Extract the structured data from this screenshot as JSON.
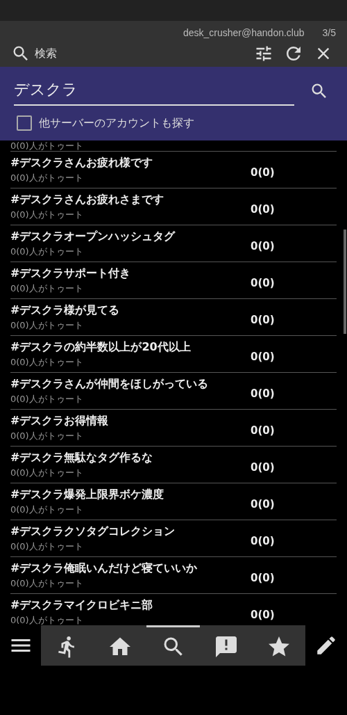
{
  "header": {
    "account": "desk_crusher@handon.club",
    "page": "3/5",
    "title": "検索"
  },
  "search_panel": {
    "query": "デスクラ",
    "other_servers": {
      "label": "他サーバーのアカウントも探す",
      "checked": false
    }
  },
  "partial_row": {
    "subtitle": "0(0)人がトゥート"
  },
  "results": [
    {
      "tag": "#デスクラさんお疲れ様です",
      "subtitle": "0(0)人がトゥート",
      "count": "0(0)"
    },
    {
      "tag": "#デスクラさんお疲れさまです",
      "subtitle": "0(0)人がトゥート",
      "count": "0(0)"
    },
    {
      "tag": "#デスクラオープンハッシュタグ",
      "subtitle": "0(0)人がトゥート",
      "count": "0(0)"
    },
    {
      "tag": "#デスクラサポート付き",
      "subtitle": "0(0)人がトゥート",
      "count": "0(0)"
    },
    {
      "tag": "#デスクラ様が見てる",
      "subtitle": "0(0)人がトゥート",
      "count": "0(0)"
    },
    {
      "tag": "#デスクラの約半数以上が20代以上",
      "subtitle": "0(0)人がトゥート",
      "count": "0(0)"
    },
    {
      "tag": "#デスクラさんが仲間をほしがっている",
      "subtitle": "0(0)人がトゥート",
      "count": "0(0)"
    },
    {
      "tag": "#デスクラお得情報",
      "subtitle": "0(0)人がトゥート",
      "count": "0(0)"
    },
    {
      "tag": "#デスクラ無駄なタグ作るな",
      "subtitle": "0(0)人がトゥート",
      "count": "0(0)"
    },
    {
      "tag": "#デスクラ爆発上限界ボケ濃度",
      "subtitle": "0(0)人がトゥート",
      "count": "0(0)"
    },
    {
      "tag": "#デスクラクソタグコレクション",
      "subtitle": "0(0)人がトゥート",
      "count": "0(0)"
    },
    {
      "tag": "#デスクラ俺眠いんだけど寝ていいか",
      "subtitle": "0(0)人がトゥート",
      "count": "0(0)"
    },
    {
      "tag": "#デスクラマイクロビキニ部",
      "subtitle": "0(0)人がトゥート",
      "count": "0(0)"
    }
  ],
  "bottom_tabs": [
    {
      "kind": "run",
      "selected": false
    },
    {
      "kind": "home",
      "selected": false
    },
    {
      "kind": "search",
      "selected": true
    },
    {
      "kind": "alert",
      "selected": false
    },
    {
      "kind": "star",
      "selected": false
    }
  ]
}
